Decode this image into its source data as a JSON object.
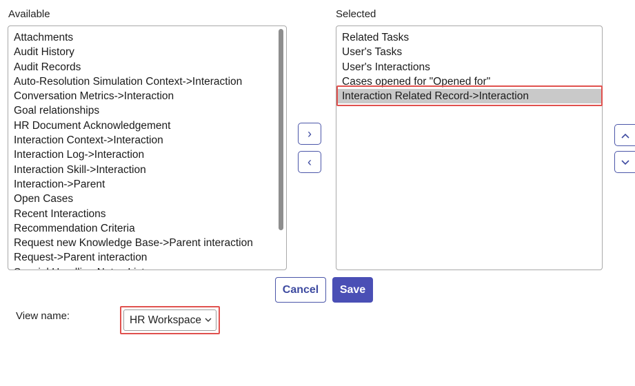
{
  "available": {
    "label": "Available",
    "items": [
      "Attachments",
      "Audit History",
      "Audit Records",
      "Auto-Resolution Simulation Context->Interaction",
      "Conversation Metrics->Interaction",
      "Goal relationships",
      "HR Document Acknowledgement",
      "Interaction Context->Interaction",
      "Interaction Log->Interaction",
      "Interaction Skill->Interaction",
      "Interaction->Parent",
      "Open Cases",
      "Recent Interactions",
      "Recommendation Criteria",
      "Request new Knowledge Base->Parent interaction",
      "Request->Parent interaction",
      "Special Handling Notes List"
    ]
  },
  "selected": {
    "label": "Selected",
    "items": [
      "Related Tasks",
      "User's Tasks",
      "User's Interactions",
      "Cases opened for \"Opened for\"",
      "Interaction Related Record->Interaction"
    ],
    "highlighted_index": 4
  },
  "move_buttons": {
    "add": "›",
    "remove": "‹"
  },
  "order_buttons": {
    "up": "⌃",
    "down": "⌄"
  },
  "actions": {
    "cancel": "Cancel",
    "save": "Save"
  },
  "view": {
    "label": "View name:",
    "value": "HR Workspace"
  },
  "colors": {
    "accent": "#4a4fb5",
    "highlight_border": "#e0504d",
    "selected_row": "#c9c9c9"
  }
}
